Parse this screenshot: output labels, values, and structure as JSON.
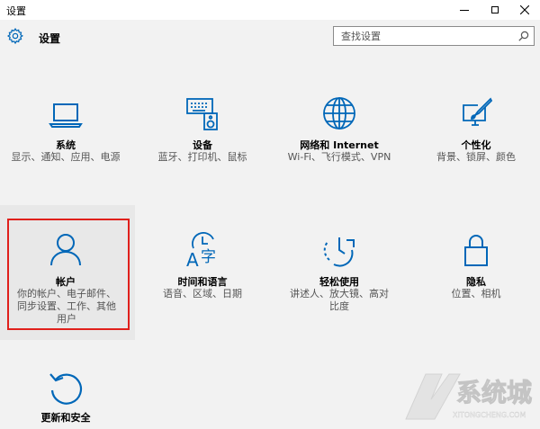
{
  "window": {
    "title": "设置"
  },
  "header": {
    "title": "设置"
  },
  "search": {
    "placeholder": "查找设置"
  },
  "tiles": [
    {
      "label": "系统",
      "desc": "显示、通知、应用、电源"
    },
    {
      "label": "设备",
      "desc": "蓝牙、打印机、鼠标"
    },
    {
      "label": "网络和 Internet",
      "desc": "Wi-Fi、飞行模式、VPN"
    },
    {
      "label": "个性化",
      "desc": "背景、锁屏、颜色"
    },
    {
      "label": "帐户",
      "desc": "你的帐户、电子邮件、同步设置、工作、其他用户"
    },
    {
      "label": "时间和语言",
      "desc": "语音、区域、日期"
    },
    {
      "label": "轻松使用",
      "desc": "讲述人、放大镜、高对比度"
    },
    {
      "label": "隐私",
      "desc": "位置、相机"
    },
    {
      "label": "更新和安全",
      "desc": ""
    }
  ],
  "accent_color": "#0067b8",
  "highlight_color": "#e0201c",
  "watermark": {
    "text": "系统城",
    "url": "XITONGCHENG.COM"
  }
}
